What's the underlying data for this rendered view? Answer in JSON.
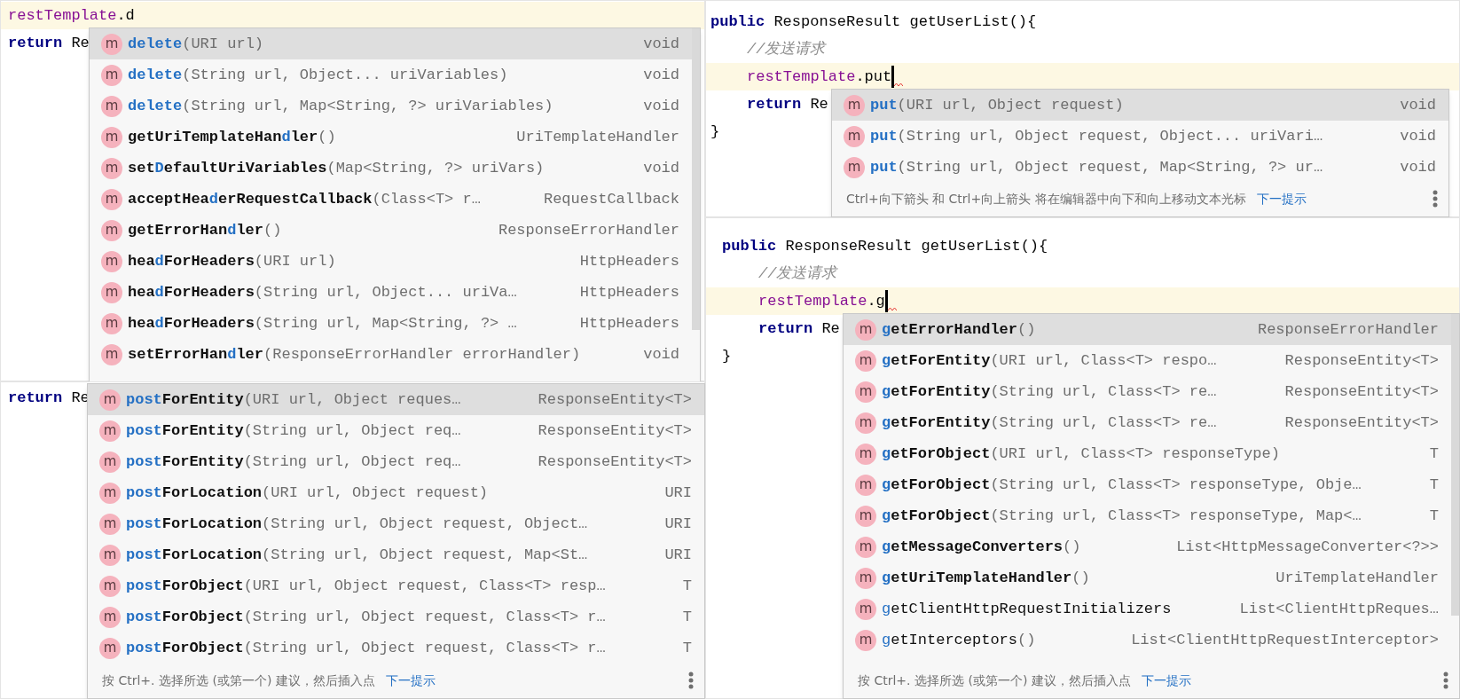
{
  "panels": [
    {
      "editor_lines": [
        {
          "current": true,
          "caret": false,
          "indented": false,
          "tokens": [
            {
              "kind": "field",
              "text": "restTemplate"
            },
            {
              "kind": "plain",
              "text": ".d"
            }
          ]
        },
        {
          "current": false,
          "caret": false,
          "indented": false,
          "tokens": [
            {
              "kind": "keyword",
              "text": "return"
            },
            {
              "kind": "plain",
              "text": " Re"
            }
          ]
        }
      ],
      "popup": {
        "items": [
          {
            "icon": "m",
            "bold": true,
            "selected": true,
            "parts": [
              {
                "text": "delete",
                "matched": true
              }
            ],
            "params": "(URI url)",
            "type": "void"
          },
          {
            "icon": "m",
            "bold": true,
            "selected": false,
            "parts": [
              {
                "text": "delete",
                "matched": true
              }
            ],
            "params": "(String url, Object... uriVariables)",
            "type": "void"
          },
          {
            "icon": "m",
            "bold": true,
            "selected": false,
            "parts": [
              {
                "text": "delete",
                "matched": true
              }
            ],
            "params": "(String url, Map<String, ?> uriVariables)",
            "type": "void"
          },
          {
            "icon": "m",
            "bold": true,
            "selected": false,
            "parts": [
              {
                "text": "getUriTemplateHan",
                "matched": false
              },
              {
                "text": "d",
                "matched": true
              },
              {
                "text": "ler",
                "matched": false
              }
            ],
            "params": "()",
            "type": "UriTemplateHandler"
          },
          {
            "icon": "m",
            "bold": true,
            "selected": false,
            "parts": [
              {
                "text": "set",
                "matched": false
              },
              {
                "text": "D",
                "matched": true
              },
              {
                "text": "efaultUriVariables",
                "matched": false
              }
            ],
            "params": "(Map<String, ?> uriVars)",
            "type": "void"
          },
          {
            "icon": "m",
            "bold": true,
            "selected": false,
            "parts": [
              {
                "text": "acceptHea",
                "matched": false
              },
              {
                "text": "d",
                "matched": true
              },
              {
                "text": "erRequestCallback",
                "matched": false
              }
            ],
            "params": "(Class<T> r…",
            "type": "RequestCallback"
          },
          {
            "icon": "m",
            "bold": true,
            "selected": false,
            "parts": [
              {
                "text": "getErrorHan",
                "matched": false
              },
              {
                "text": "d",
                "matched": true
              },
              {
                "text": "ler",
                "matched": false
              }
            ],
            "params": "()",
            "type": "ResponseErrorHandler"
          },
          {
            "icon": "m",
            "bold": true,
            "selected": false,
            "parts": [
              {
                "text": "hea",
                "matched": false
              },
              {
                "text": "d",
                "matched": true
              },
              {
                "text": "ForHeaders",
                "matched": false
              }
            ],
            "params": "(URI url)",
            "type": "HttpHeaders"
          },
          {
            "icon": "m",
            "bold": true,
            "selected": false,
            "parts": [
              {
                "text": "hea",
                "matched": false
              },
              {
                "text": "d",
                "matched": true
              },
              {
                "text": "ForHeaders",
                "matched": false
              }
            ],
            "params": "(String url, Object... uriVa…",
            "type": "HttpHeaders"
          },
          {
            "icon": "m",
            "bold": true,
            "selected": false,
            "parts": [
              {
                "text": "hea",
                "matched": false
              },
              {
                "text": "d",
                "matched": true
              },
              {
                "text": "ForHeaders",
                "matched": false
              }
            ],
            "params": "(String url, Map<String, ?> …",
            "type": "HttpHeaders"
          },
          {
            "icon": "m",
            "bold": true,
            "selected": false,
            "parts": [
              {
                "text": "setErrorHan",
                "matched": false
              },
              {
                "text": "d",
                "matched": true
              },
              {
                "text": "ler",
                "matched": false
              }
            ],
            "params": "(ResponseErrorHandler errorHandler)",
            "type": "void"
          }
        ]
      }
    },
    {
      "editor_lines": [
        {
          "current": false,
          "caret": false,
          "indented": false,
          "tokens": [
            {
              "kind": "keyword",
              "text": "return"
            },
            {
              "kind": "plain",
              "text": " Re"
            }
          ]
        }
      ],
      "popup": {
        "items": [
          {
            "icon": "m",
            "bold": true,
            "selected": true,
            "parts": [
              {
                "text": "post",
                "matched": true
              },
              {
                "text": "ForEntity",
                "matched": false
              }
            ],
            "params": "(URI url, Object reques…",
            "type": "ResponseEntity<T>"
          },
          {
            "icon": "m",
            "bold": true,
            "selected": false,
            "parts": [
              {
                "text": "post",
                "matched": true
              },
              {
                "text": "ForEntity",
                "matched": false
              }
            ],
            "params": "(String url, Object req…",
            "type": "ResponseEntity<T>"
          },
          {
            "icon": "m",
            "bold": true,
            "selected": false,
            "parts": [
              {
                "text": "post",
                "matched": true
              },
              {
                "text": "ForEntity",
                "matched": false
              }
            ],
            "params": "(String url, Object req…",
            "type": "ResponseEntity<T>"
          },
          {
            "icon": "m",
            "bold": true,
            "selected": false,
            "parts": [
              {
                "text": "post",
                "matched": true
              },
              {
                "text": "ForLocation",
                "matched": false
              }
            ],
            "params": "(URI url, Object request)",
            "type": "URI"
          },
          {
            "icon": "m",
            "bold": true,
            "selected": false,
            "parts": [
              {
                "text": "post",
                "matched": true
              },
              {
                "text": "ForLocation",
                "matched": false
              }
            ],
            "params": "(String url, Object request, Object…",
            "type": "URI"
          },
          {
            "icon": "m",
            "bold": true,
            "selected": false,
            "parts": [
              {
                "text": "post",
                "matched": true
              },
              {
                "text": "ForLocation",
                "matched": false
              }
            ],
            "params": "(String url, Object request, Map<St…",
            "type": "URI"
          },
          {
            "icon": "m",
            "bold": true,
            "selected": false,
            "parts": [
              {
                "text": "post",
                "matched": true
              },
              {
                "text": "ForObject",
                "matched": false
              }
            ],
            "params": "(URI url, Object request, Class<T> resp…",
            "type": "T"
          },
          {
            "icon": "m",
            "bold": true,
            "selected": false,
            "parts": [
              {
                "text": "post",
                "matched": true
              },
              {
                "text": "ForObject",
                "matched": false
              }
            ],
            "params": "(String url, Object request, Class<T> r…",
            "type": "T"
          },
          {
            "icon": "m",
            "bold": true,
            "selected": false,
            "parts": [
              {
                "text": "post",
                "matched": true
              },
              {
                "text": "ForObject",
                "matched": false
              }
            ],
            "params": "(String url, Object request, Class<T> r…",
            "type": "T"
          }
        ],
        "footer": {
          "hint": "按 Ctrl+. 选择所选 (或第一个) 建议，然后插入点",
          "link": "下一提示"
        }
      }
    },
    {
      "editor_lines": [
        {
          "current": false,
          "caret": false,
          "indented": false,
          "tokens": [
            {
              "kind": "keyword",
              "text": "public"
            },
            {
              "kind": "plain",
              "text": " ResponseResult getUserList(){"
            }
          ]
        },
        {
          "current": false,
          "caret": false,
          "indented": true,
          "tokens": [
            {
              "kind": "comment",
              "text": "//发送请求"
            }
          ]
        },
        {
          "current": true,
          "caret": true,
          "indented": true,
          "tokens": [
            {
              "kind": "field",
              "text": "restTemplate"
            },
            {
              "kind": "plain",
              "text": ".put"
            }
          ]
        },
        {
          "current": false,
          "caret": false,
          "indented": true,
          "tokens": [
            {
              "kind": "keyword",
              "text": "return"
            },
            {
              "kind": "plain",
              "text": " Re"
            }
          ]
        },
        {
          "current": false,
          "caret": false,
          "indented": false,
          "tokens": [
            {
              "kind": "plain",
              "text": "}"
            }
          ]
        }
      ],
      "popup": {
        "items": [
          {
            "icon": "m",
            "bold": true,
            "selected": true,
            "parts": [
              {
                "text": "put",
                "matched": true
              }
            ],
            "params": "(URI url, Object request)",
            "type": "void"
          },
          {
            "icon": "m",
            "bold": true,
            "selected": false,
            "parts": [
              {
                "text": "put",
                "matched": true
              }
            ],
            "params": "(String url, Object request, Object... uriVari…",
            "type": "void"
          },
          {
            "icon": "m",
            "bold": true,
            "selected": false,
            "parts": [
              {
                "text": "put",
                "matched": true
              }
            ],
            "params": "(String url, Object request, Map<String, ?> ur…",
            "type": "void"
          }
        ],
        "footer": {
          "hint": "Ctrl+向下箭头 和 Ctrl+向上箭头 将在编辑器中向下和向上移动文本光标",
          "link": "下一提示"
        }
      }
    },
    {
      "editor_lines": [
        {
          "current": false,
          "caret": false,
          "indented": false,
          "tokens": [
            {
              "kind": "keyword",
              "text": "public"
            },
            {
              "kind": "plain",
              "text": " ResponseResult getUserList(){"
            }
          ]
        },
        {
          "current": false,
          "caret": false,
          "indented": true,
          "tokens": [
            {
              "kind": "comment",
              "text": "//发送请求"
            }
          ]
        },
        {
          "current": true,
          "caret": true,
          "indented": true,
          "tokens": [
            {
              "kind": "field",
              "text": "restTemplate"
            },
            {
              "kind": "plain",
              "text": ".g"
            }
          ]
        },
        {
          "current": false,
          "caret": false,
          "indented": true,
          "tokens": [
            {
              "kind": "keyword",
              "text": "return"
            },
            {
              "kind": "plain",
              "text": " Re"
            }
          ]
        },
        {
          "current": false,
          "caret": false,
          "indented": false,
          "tokens": [
            {
              "kind": "plain",
              "text": "}"
            }
          ]
        }
      ],
      "popup": {
        "items": [
          {
            "icon": "m",
            "bold": true,
            "selected": true,
            "parts": [
              {
                "text": "g",
                "matched": true
              },
              {
                "text": "etErrorHandler",
                "matched": false
              }
            ],
            "params": "()",
            "type": "ResponseErrorHandler"
          },
          {
            "icon": "m",
            "bold": true,
            "selected": false,
            "parts": [
              {
                "text": "g",
                "matched": true
              },
              {
                "text": "etForEntity",
                "matched": false
              }
            ],
            "params": "(URI url, Class<T> respo…",
            "type": "ResponseEntity<T>"
          },
          {
            "icon": "m",
            "bold": true,
            "selected": false,
            "parts": [
              {
                "text": "g",
                "matched": true
              },
              {
                "text": "etForEntity",
                "matched": false
              }
            ],
            "params": "(String url, Class<T> re…",
            "type": "ResponseEntity<T>"
          },
          {
            "icon": "m",
            "bold": true,
            "selected": false,
            "parts": [
              {
                "text": "g",
                "matched": true
              },
              {
                "text": "etForEntity",
                "matched": false
              }
            ],
            "params": "(String url, Class<T> re…",
            "type": "ResponseEntity<T>"
          },
          {
            "icon": "m",
            "bold": true,
            "selected": false,
            "parts": [
              {
                "text": "g",
                "matched": true
              },
              {
                "text": "etForObject",
                "matched": false
              }
            ],
            "params": "(URI url, Class<T> responseType)",
            "type": "T"
          },
          {
            "icon": "m",
            "bold": true,
            "selected": false,
            "parts": [
              {
                "text": "g",
                "matched": true
              },
              {
                "text": "etForObject",
                "matched": false
              }
            ],
            "params": "(String url, Class<T> responseType, Obje…",
            "type": "T"
          },
          {
            "icon": "m",
            "bold": true,
            "selected": false,
            "parts": [
              {
                "text": "g",
                "matched": true
              },
              {
                "text": "etForObject",
                "matched": false
              }
            ],
            "params": "(String url, Class<T> responseType, Map<…",
            "type": "T"
          },
          {
            "icon": "m",
            "bold": true,
            "selected": false,
            "parts": [
              {
                "text": "g",
                "matched": true
              },
              {
                "text": "etMessageConverters",
                "matched": false
              }
            ],
            "params": "()",
            "type": "List<HttpMessageConverter<?>>"
          },
          {
            "icon": "m",
            "bold": true,
            "selected": false,
            "parts": [
              {
                "text": "g",
                "matched": true
              },
              {
                "text": "etUriTemplateHandler",
                "matched": false
              }
            ],
            "params": "()",
            "type": "UriTemplateHandler"
          },
          {
            "icon": "m",
            "bold": false,
            "selected": false,
            "parts": [
              {
                "text": "g",
                "matched": true
              },
              {
                "text": "etClientHttpRequestInitializers",
                "matched": false
              }
            ],
            "type": "List<ClientHttpReques…"
          },
          {
            "icon": "m",
            "bold": false,
            "selected": false,
            "parts": [
              {
                "text": "g",
                "matched": true
              },
              {
                "text": "etInterceptors",
                "matched": false
              }
            ],
            "params": "()",
            "type": "List<ClientHttpRequestInterceptor>"
          }
        ],
        "footer": {
          "hint": "按 Ctrl+. 选择所选 (或第一个) 建议，然后插入点",
          "link": "下一提示"
        }
      }
    }
  ]
}
